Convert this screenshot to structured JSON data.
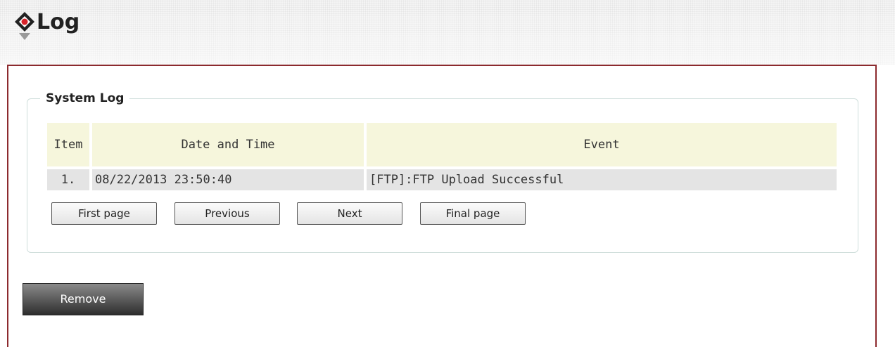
{
  "header": {
    "title": "Log"
  },
  "system_log": {
    "legend": "System Log",
    "columns": [
      "Item",
      "Date and Time",
      "Event"
    ],
    "rows": [
      {
        "item": "1.",
        "datetime": "08/22/2013 23:50:40",
        "event": "[FTP]:FTP Upload Successful"
      }
    ]
  },
  "pagination": {
    "first": "First page",
    "previous": "Previous",
    "next": "Next",
    "final": "Final page"
  },
  "actions": {
    "remove": "Remove"
  },
  "colors": {
    "panel_border": "#8c2a2e",
    "table_header_bg": "#f6f6dc",
    "row_bg": "#e4e4e4",
    "remove_button_bg": "#3a3a3a"
  }
}
